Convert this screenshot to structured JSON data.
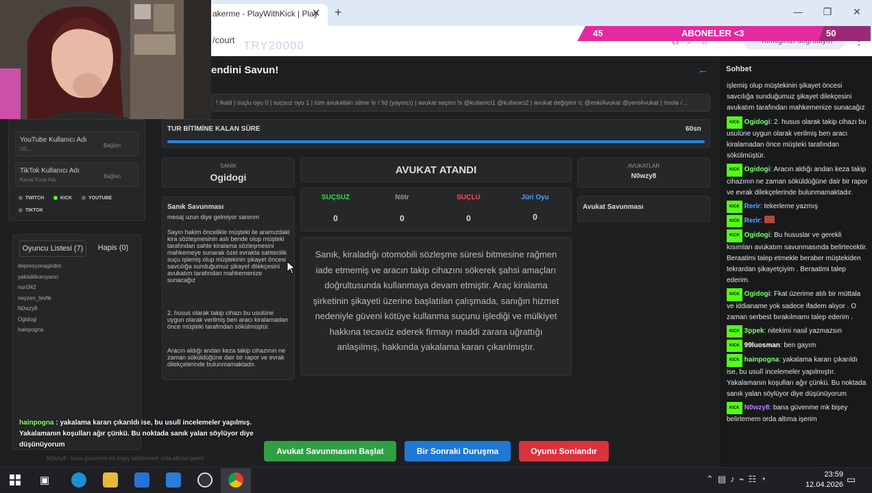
{
  "browser": {
    "tab_title": "akerme - PlayWithKick | Play",
    "url": "/court",
    "ghost_text": "TRY20000",
    "profile_label": "Kimliğinizi doğrulayın"
  },
  "sub_bar": {
    "left": "45",
    "title": "ABONELER <3",
    "right": "50"
  },
  "page": {
    "title": "endini Savun!",
    "command_hint": "! /katil | suçlu oyu 0 | suçsuz oyu 1 | tüm avukatları silme !ir / !id (yayıncı) | avukat seçimi !s @kullanici1 @kullanici2 | avukat değişimi !c @eskiAvukat @yeniAvukat | !mola / ..."
  },
  "timer": {
    "label": "TUR BİTİMİNE KALAN SÜRE",
    "value": "60sn",
    "progress": 1.0
  },
  "accounts": [
    {
      "title": "YouTube Kullanıcı Adı",
      "sub": "UC...",
      "connect": "Bağlan"
    },
    {
      "title": "TikTok Kullanıcı Adı",
      "sub": "Kanal Kısa Adı",
      "connect": "Bağlan"
    }
  ],
  "platforms": [
    "TWITCH",
    "KICK",
    "YOUTUBE",
    "TIKTOK"
  ],
  "player_tabs": {
    "players": "Oyuncu Listesi (7)",
    "jail": "Hapis (0)"
  },
  "players": [
    "depresyonagirdim",
    "yakisiklicenyanci",
    "nuri342",
    "neyzen_tevfik",
    "N0wzy8",
    "Ogidogi",
    "hainpogna"
  ],
  "defendant": {
    "label": "SANIK",
    "name": "Ogidogi"
  },
  "defense": {
    "heading": "Sanık Savunması",
    "subtitle": "mesaj uzun diye gelmiyor sanırım",
    "p1": "Sayın hakim öncelikle müşteki ile aramızdaki kira sözleşmesinin aslı bende olup müşteki tarafından sahte kiralama sözleşmesini mahkemeye sunarak özel evrakta sahtecilik suçu işlemiş olup müştekinin şikayet öncesi savcılığa sunduğumuz şikayet dilekçesini avukatım tarafından mahkemenize sunacağız",
    "p2": "2. husus olarak takip cihazı bu usulüne uygun olarak verilmiş ben aracı kiralamadan önce müşteki tarafından sökülmüştür.",
    "p3": "Aracın aldığı andan keza takip cihazının ne zaman söküldüğüne dair bir rapor ve evrak dilekçelerinde bulunmamaktadır."
  },
  "assigned": "AVUKAT ATANDI",
  "votes": [
    {
      "label": "SUÇSUZ",
      "value": "0",
      "color": "#3ddc4a"
    },
    {
      "label": "Nötr",
      "value": "0",
      "color": "#9a9a9a"
    },
    {
      "label": "SUÇLU",
      "value": "0",
      "color": "#ff4d5a"
    },
    {
      "label": "Jüri Oyu",
      "value": "0",
      "color": "#4aa3ff"
    }
  ],
  "verdict": "Sanık, kiraladığı otomobili sözleşme süresi bitmesine rağmen iade etmemiş ve aracın takip cihazını sökerek şahsi amaçları doğrultusunda kullanmaya devam etmiştir. Araç kiralama şirketinin şikayeti üzerine başlatılan çalışmada, sanığın hizmet nedeniyle güveni kötüye kullanma suçunu işlediği ve mülkiyet hakkına tecavüz ederek firmayı maddi zarara uğrattığı anlaşılmış, hakkında yakalama kararı çıkarılmıştır.",
  "lawyers": {
    "label": "AVUKATLAR",
    "name": "N0wzy8",
    "defense_heading": "Avukat Savunması"
  },
  "buttons": {
    "start": "Avukat Savunmasını Başlat",
    "next": "Bir Sonraki Duruşma",
    "end": "Oyunu Sonlandır"
  },
  "overlay": {
    "user": "hainpogna",
    "text": "yakalama kararı çıkarıldı ise, bu usulî incelemeler yapılmış. Yakalamanın koşulları ağır çünkü. Bu noktada sanık yalan söylüyor diye düşünüyorum",
    "faint": "N0wzy8 : bana güvenme mk bişey belirtemem orda altıma işerim"
  },
  "chat": {
    "title": "Sohbet",
    "intro": "işlemiş olup müştekinin şikayet öncesi savcılığa sunduğumuz şikayet dilekçesini avukatım tarafından mahkemenize sunacağız",
    "messages": [
      {
        "badge": "KICK",
        "user": "Ogidogi",
        "user_color": "#7dff6b",
        "text": "2. husus olarak takip cihazı bu usulüne uygun olarak verilmiş ben aracı kiralamadan önce müşteki tarafından sökülmüştür."
      },
      {
        "badge": "KICK",
        "user": "Ogidogi",
        "user_color": "#7dff6b",
        "text": "Aracın aldığı andan keza takip cihazının ne zaman söküldüğüne dair bir rapor ve evrak dilekçelerinde bulunmamaktadır."
      },
      {
        "badge": "KICK",
        "user": "Rerir",
        "user_color": "#5aa8ff",
        "text": "tekerleme yazmış"
      },
      {
        "badge": "KICK",
        "user": "Rerir",
        "user_color": "#5aa8ff",
        "text": ""
      },
      {
        "badge": "KICK",
        "user": "Ogidogi",
        "user_color": "#7dff6b",
        "text": "Bu hususlar ve gerekli kısımları avukatım savunmasında belirtecektir. Beraatimi talep etmekle beraber müştekiden tekrardan şikayetçiyim . Beraatimi talep ederim."
      },
      {
        "badge": "KICK",
        "user": "Ogidogi",
        "user_color": "#7dff6b",
        "text": "Fkat üzerime atılı bir müttala ve iddianame yok sadece ifadem alıyor . O zaman serbest bırakılmamı talep ederim ."
      },
      {
        "badge": "KICK",
        "user": "3ppek",
        "user_color": "#7dff6b",
        "text": "nitekimi nasil yazmazsın"
      },
      {
        "badge": "KICK",
        "user": "99luosman",
        "user_color": "#ffffff",
        "text": "ben gayım"
      },
      {
        "badge": "KICK",
        "user": "hainpogna",
        "user_color": "#7dff6b",
        "text": "yakalama kararı çıkarıldı ise, bu usulî incelemeler yapılmıştır. Yakalamanın koşulları ağır çünkü. Bu noktada sanık yalan söylüyor diye düşünüyorum"
      },
      {
        "badge": "KICK",
        "user": "N0wzy8",
        "user_color": "#c27cff",
        "text": "bana güvenme mk bişey belirtemem orda altıma işerim"
      }
    ]
  },
  "taskbar": {
    "time": "23:59",
    "date": "12.04.2026"
  }
}
